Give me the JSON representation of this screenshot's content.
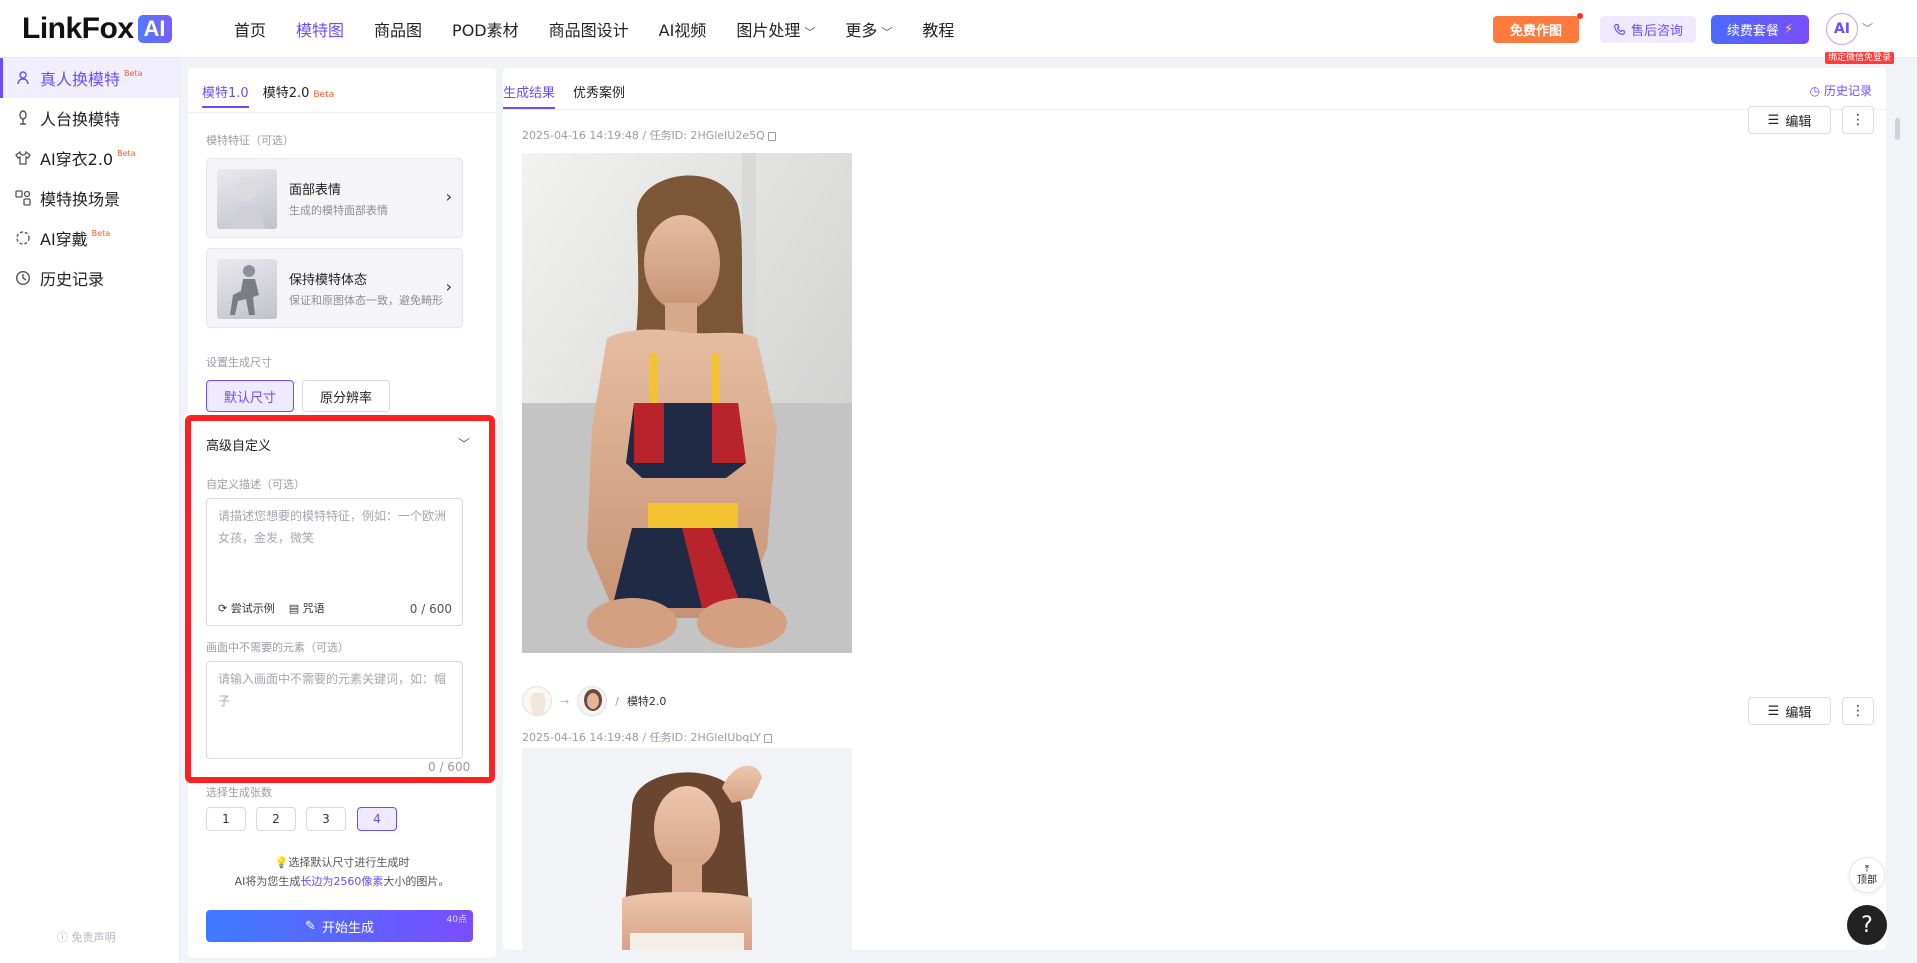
{
  "brand": {
    "logo_text": "LinkFox",
    "logo_badge": "AI"
  },
  "nav": {
    "items": [
      {
        "label": "首页",
        "active": false,
        "has_dropdown": false
      },
      {
        "label": "模特图",
        "active": true,
        "has_dropdown": false
      },
      {
        "label": "商品图",
        "active": false,
        "has_dropdown": false
      },
      {
        "label": "POD素材",
        "active": false,
        "has_dropdown": false
      },
      {
        "label": "商品图设计",
        "active": false,
        "has_dropdown": false
      },
      {
        "label": "AI视频",
        "active": false,
        "has_dropdown": false
      },
      {
        "label": "图片处理",
        "active": false,
        "has_dropdown": true
      },
      {
        "label": "更多",
        "active": false,
        "has_dropdown": true
      },
      {
        "label": "教程",
        "active": false,
        "has_dropdown": false
      }
    ],
    "free_btn": "免费作图",
    "consult_btn": "售后咨询",
    "renew_btn": "续费套餐",
    "avatar_text": "AI",
    "wechat_tag": "绑定微信免登录"
  },
  "sidebar": {
    "items": [
      {
        "label": "真人换模特",
        "beta": "Beta",
        "active": true
      },
      {
        "label": "人台换模特",
        "beta": "",
        "active": false
      },
      {
        "label": "AI穿衣2.0",
        "beta": "Beta",
        "active": false
      },
      {
        "label": "模特换场景",
        "beta": "",
        "active": false
      },
      {
        "label": "AI穿戴",
        "beta": "Beta",
        "active": false
      },
      {
        "label": "历史记录",
        "beta": "",
        "active": false
      }
    ],
    "disclaimer": "免责声明"
  },
  "panel": {
    "tab1": "模特1.0",
    "tab2": "模特2.0",
    "tab2_beta": "Beta",
    "feature_label": "模特特征（可选）",
    "cards": [
      {
        "title": "面部表情",
        "desc": "生成的模特面部表情"
      },
      {
        "title": "保持模特体态",
        "desc": "保证和原图体态一致，避免畸形"
      }
    ],
    "size_label": "设置生成尺寸",
    "size_default": "默认尺寸",
    "size_original": "原分辨率",
    "advanced_title": "高级自定义",
    "custom_label": "自定义描述（可选）",
    "custom_placeholder": "请描述您想要的模特特征，例如：一个欧洲女孩，金发，微笑",
    "try_example": "尝试示例",
    "phrases": "咒语",
    "custom_count": "0 / 600",
    "negative_label": "画面中不需要的元素（可选）",
    "negative_placeholder": "请输入画面中不需要的元素关键词，如：帽子",
    "negative_count": "0 / 600",
    "count_label": "选择生成张数",
    "counts": [
      "1",
      "2",
      "3",
      "4"
    ],
    "selected_count": "4",
    "tip_line1": "选择默认尺寸进行生成时",
    "tip_line2_a": "AI将为您生成",
    "tip_line2_hl": "长边为2560像素",
    "tip_line2_b": "大小的图片。",
    "generate_btn": "开始生成",
    "points": "40点"
  },
  "results": {
    "tab_results": "生成结果",
    "tab_cases": "优秀案例",
    "history": "历史记录",
    "edit_label": "编辑",
    "items": [
      {
        "meta": "2025-04-16 14:19:48 / 任务ID: 2HGleIU2e5Q",
        "model_tag": ""
      },
      {
        "meta": "2025-04-16 14:19:48 / 任务ID: 2HGleIUbqLY",
        "model_tag": "模特2.0"
      }
    ]
  },
  "floating": {
    "top_label": "顶部",
    "help": "?"
  }
}
